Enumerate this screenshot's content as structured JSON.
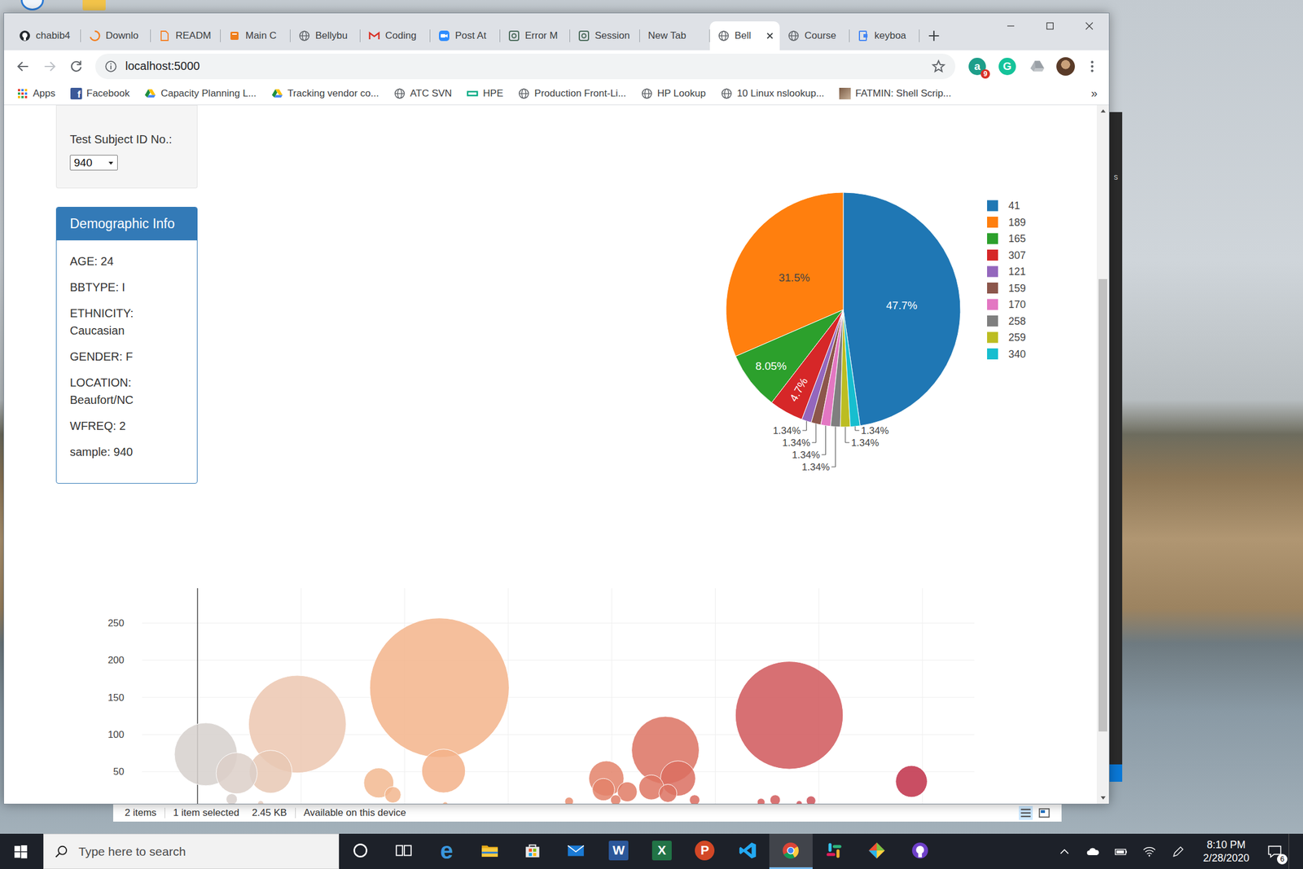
{
  "tabs": [
    {
      "label": "chabib4",
      "kind": "github",
      "selected": false
    },
    {
      "label": "Downlo",
      "kind": "loader",
      "selected": false
    },
    {
      "label": "READM",
      "kind": "doc",
      "selected": false
    },
    {
      "label": "Main C",
      "kind": "book",
      "selected": false
    },
    {
      "label": "Bellybu",
      "kind": "globe",
      "selected": false
    },
    {
      "label": "Coding",
      "kind": "gmail",
      "selected": false
    },
    {
      "label": "Post At",
      "kind": "zoom",
      "selected": false
    },
    {
      "label": "Error M",
      "kind": "target",
      "selected": false
    },
    {
      "label": "Session",
      "kind": "target",
      "selected": false
    },
    {
      "label": "New Tab",
      "kind": "none",
      "selected": false
    },
    {
      "label": "Bell",
      "kind": "globe",
      "selected": true
    },
    {
      "label": "Course",
      "kind": "globe",
      "selected": false
    },
    {
      "label": "keyboa",
      "kind": "keyboard",
      "selected": false
    }
  ],
  "address_bar": {
    "url": "localhost:5000"
  },
  "extensions": [
    {
      "kind": "letter",
      "glyph": "a",
      "badge": "9",
      "color": "#1e9e8a"
    },
    {
      "kind": "letter",
      "glyph": "G",
      "color": "#15c39a"
    },
    {
      "kind": "drive",
      "color": "#9aa0a6"
    }
  ],
  "bookmarks": [
    {
      "label": "Apps",
      "kind": "apps"
    },
    {
      "label": "Facebook",
      "kind": "facebook",
      "glyph": "f"
    },
    {
      "label": "Capacity Planning L...",
      "kind": "drive"
    },
    {
      "label": "Tracking vendor co...",
      "kind": "drive"
    },
    {
      "label": "ATC SVN",
      "kind": "globe"
    },
    {
      "label": "HPE",
      "kind": "hpe"
    },
    {
      "label": "Production Front-Li...",
      "kind": "globe"
    },
    {
      "label": "HP Lookup",
      "kind": "globe"
    },
    {
      "label": "10 Linux nslookup...",
      "kind": "globe"
    },
    {
      "label": "FATMIN: Shell Scrip...",
      "kind": "photo"
    }
  ],
  "bookmarks_overflow": "»",
  "subject_select": {
    "label": "Test Subject ID No.:",
    "value": "940"
  },
  "demographics": {
    "title": "Demographic Info",
    "lines": [
      "AGE: 24",
      "BBTYPE: I",
      "ETHNICITY: Caucasian",
      "GENDER: F",
      "LOCATION: Beaufort/NC",
      "WFREQ: 2",
      "sample: 940"
    ]
  },
  "pie_chart": {
    "slices": [
      {
        "label": "41",
        "value": 47.7,
        "text": "47.7%",
        "kind": "inside",
        "color": "#1f77b4"
      },
      {
        "label": "189",
        "value": 31.5,
        "text": "31.5%",
        "kind": "inside",
        "color": "#ff7f0e"
      },
      {
        "label": "165",
        "value": 8.05,
        "text": "8.05%",
        "kind": "inside",
        "color": "#2ca02c"
      },
      {
        "label": "307",
        "value": 4.7,
        "text": "4.7%",
        "kind": "inside",
        "color": "#d62728"
      },
      {
        "label": "121",
        "value": 1.34,
        "text": "1.34%",
        "kind": "outside",
        "color": "#9467bd"
      },
      {
        "label": "159",
        "value": 1.34,
        "text": "1.34%",
        "kind": "outside",
        "color": "#8c564b"
      },
      {
        "label": "170",
        "value": 1.34,
        "text": "1.34%",
        "kind": "outside",
        "color": "#e377c2"
      },
      {
        "label": "258",
        "value": 1.34,
        "text": "1.34%",
        "kind": "outside",
        "color": "#7f7f7f"
      },
      {
        "label": "259",
        "value": 1.34,
        "text": "1.34%",
        "kind": "outside",
        "color": "#bcbd22"
      },
      {
        "label": "340",
        "value": 1.34,
        "text": "1.34%",
        "kind": "outside",
        "color": "#17becf"
      }
    ]
  },
  "bubble_chart": {
    "y_ticks": [
      "250",
      "200",
      "150",
      "100",
      "50"
    ],
    "points": [
      {
        "x": 40,
        "y": 73.5,
        "color": "#d6d0cd"
      },
      {
        "x": 165,
        "y": 13,
        "color": "#d8d0cc"
      },
      {
        "x": 189,
        "y": 48,
        "color": "#dccfc8"
      },
      {
        "x": 305,
        "y": 7,
        "color": "#e4cbbd"
      },
      {
        "x": 353,
        "y": 50,
        "color": "#e8c8b4"
      },
      {
        "x": 482,
        "y": 114,
        "color": "#ecc7b0"
      },
      {
        "x": 875,
        "y": 35,
        "color": "#f2b891"
      },
      {
        "x": 943,
        "y": 19,
        "color": "#f2b68e"
      },
      {
        "x": 1168,
        "y": 163,
        "color": "#f3b48b"
      },
      {
        "x": 1188,
        "y": 51,
        "color": "#f3b28a"
      },
      {
        "x": 1196,
        "y": 6,
        "color": "#f3b28a"
      },
      {
        "x": 1794,
        "y": 10,
        "color": "#e78c6f"
      },
      {
        "x": 1960,
        "y": 26,
        "color": "#e3826a"
      },
      {
        "x": 1974,
        "y": 41,
        "color": "#e3826a"
      },
      {
        "x": 2019,
        "y": 12,
        "color": "#e17e67"
      },
      {
        "x": 2075,
        "y": 23,
        "color": "#e07b65"
      },
      {
        "x": 2191,
        "y": 29,
        "color": "#de7563"
      },
      {
        "x": 2259,
        "y": 79,
        "color": "#dc7261"
      },
      {
        "x": 2271,
        "y": 21,
        "color": "#dc7261"
      },
      {
        "x": 2320,
        "y": 41,
        "color": "#db6f60"
      },
      {
        "x": 2400,
        "y": 12,
        "color": "#d96b5f"
      },
      {
        "x": 2721,
        "y": 9,
        "color": "#d35c5b"
      },
      {
        "x": 2789,
        "y": 12,
        "color": "#d15a5a"
      },
      {
        "x": 2857,
        "y": 126,
        "color": "#d0575a"
      },
      {
        "x": 2905,
        "y": 7,
        "color": "#ce5459"
      },
      {
        "x": 2962,
        "y": 11,
        "color": "#cd5158"
      },
      {
        "x": 3447,
        "y": 37,
        "color": "#bf2f48"
      }
    ]
  },
  "scrollbar": {
    "thumb_start": 0.24,
    "thumb_size": 0.67
  },
  "side_window": {
    "text": "s"
  },
  "explorer_status": {
    "count": "2 items",
    "selection": "1 item selected",
    "size": "2.45 KB",
    "availability": "Available on this device"
  },
  "taskbar": {
    "search_placeholder": "Type here to search",
    "apps": [
      {
        "kind": "cortana",
        "selected": false
      },
      {
        "kind": "taskview",
        "selected": false
      },
      {
        "kind": "edge",
        "glyph": "e",
        "selected": false
      },
      {
        "kind": "explorer",
        "selected": false
      },
      {
        "kind": "store",
        "selected": false
      },
      {
        "kind": "mail",
        "selected": false
      },
      {
        "kind": "word",
        "glyph": "W",
        "selected": false
      },
      {
        "kind": "excel",
        "glyph": "X",
        "selected": false
      },
      {
        "kind": "powerpoint",
        "glyph": "P",
        "selected": false
      },
      {
        "kind": "vscode",
        "selected": false
      },
      {
        "kind": "chrome",
        "selected": true
      },
      {
        "kind": "slack",
        "selected": false
      },
      {
        "kind": "git",
        "selected": false
      },
      {
        "kind": "github",
        "selected": false
      }
    ],
    "tray": {
      "time": "8:10 PM",
      "date": "2/28/2020",
      "notifications": "6"
    }
  }
}
